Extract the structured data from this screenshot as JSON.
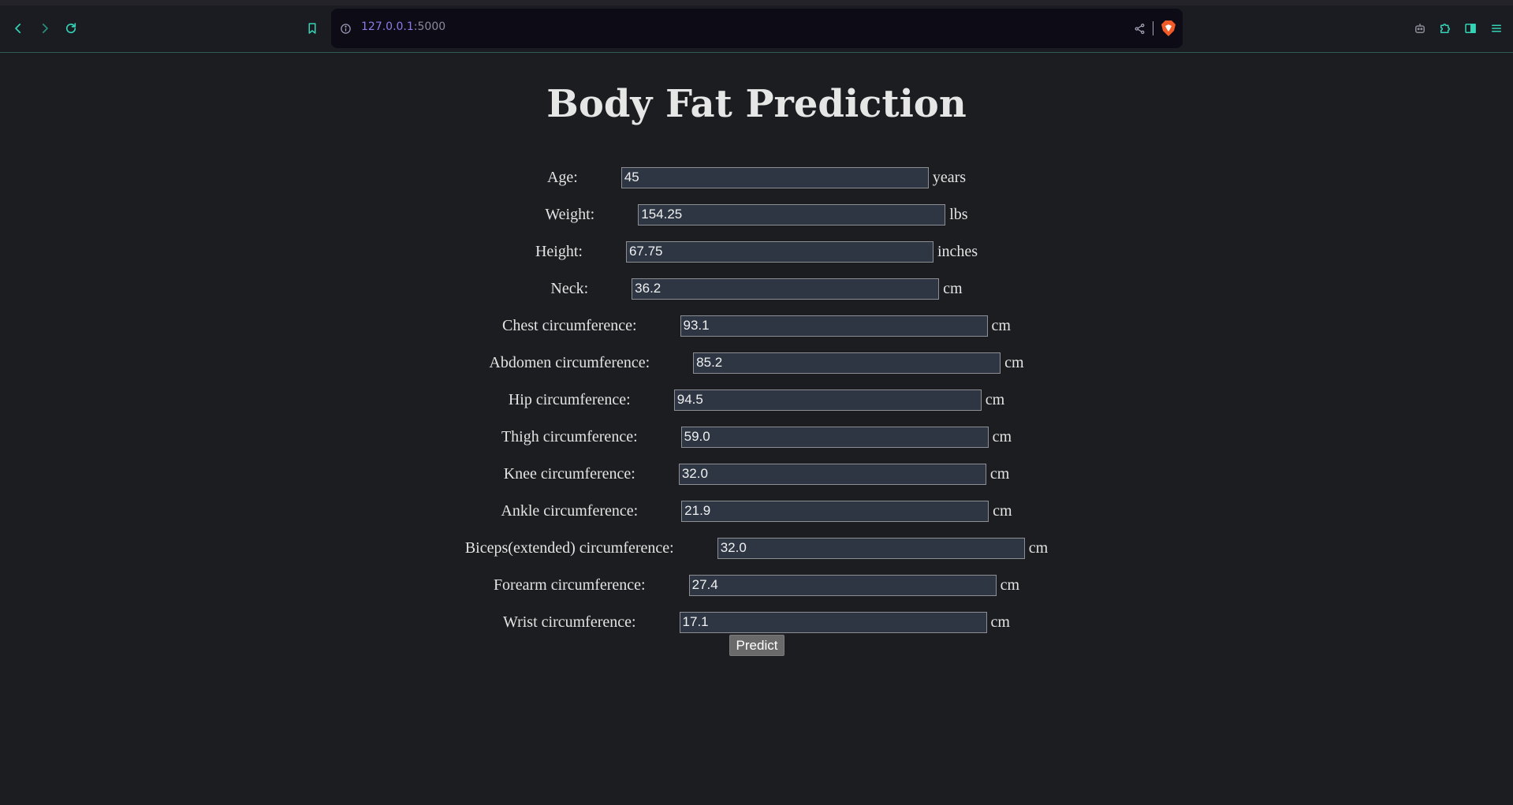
{
  "browser": {
    "url_host": "127.0.0.1",
    "url_port": ":5000",
    "icons": [
      "back-icon",
      "forward-icon",
      "reload-icon",
      "bookmark-icon",
      "site-info-icon",
      "share-icon",
      "brave-shield-icon",
      "leo-ai-icon",
      "extensions-icon",
      "sidebar-icon",
      "menu-icon"
    ],
    "accent": "#35d3b5"
  },
  "page": {
    "title": "Body Fat Prediction",
    "fields": [
      {
        "label": "Age:",
        "value": "45",
        "unit": "years"
      },
      {
        "label": "Weight:",
        "value": "154.25",
        "unit": "lbs"
      },
      {
        "label": "Height:",
        "value": "67.75",
        "unit": "inches"
      },
      {
        "label": "Neck:",
        "value": "36.2",
        "unit": "cm"
      },
      {
        "label": "Chest circumference:",
        "value": "93.1",
        "unit": "cm"
      },
      {
        "label": "Abdomen circumference:",
        "value": "85.2",
        "unit": "cm"
      },
      {
        "label": "Hip circumference:",
        "value": "94.5",
        "unit": "cm"
      },
      {
        "label": "Thigh circumference:",
        "value": "59.0",
        "unit": "cm"
      },
      {
        "label": "Knee circumference:",
        "value": "32.0",
        "unit": "cm"
      },
      {
        "label": "Ankle circumference:",
        "value": "21.9",
        "unit": "cm"
      },
      {
        "label": "Biceps(extended) circumference:",
        "value": "32.0",
        "unit": "cm"
      },
      {
        "label": "Forearm circumference:",
        "value": "27.4",
        "unit": "cm"
      },
      {
        "label": "Wrist circumference:",
        "value": "17.1",
        "unit": "cm"
      }
    ],
    "predict_label": "Predict"
  }
}
